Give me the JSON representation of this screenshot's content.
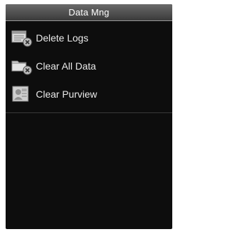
{
  "header": {
    "title": "Data Mng"
  },
  "menu": {
    "items": [
      {
        "label": "Delete Logs",
        "icon": "delete-logs-icon"
      },
      {
        "label": "Clear All Data",
        "icon": "clear-data-icon"
      },
      {
        "label": "Clear Purview",
        "icon": "clear-purview-icon"
      }
    ]
  },
  "colors": {
    "background": "#0d0d0d",
    "title_bar": "#4a4a4a",
    "text": "#eaeaea"
  }
}
